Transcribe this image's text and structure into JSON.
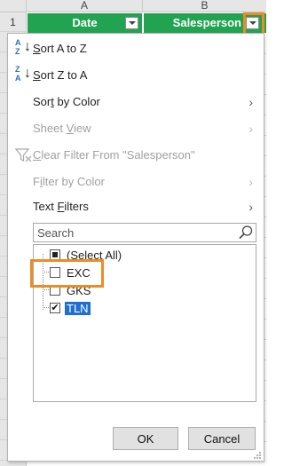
{
  "sheet": {
    "columns": [
      "A",
      "B"
    ],
    "first_row_number": "1",
    "header_cells": {
      "date": "Date",
      "salesperson": "Salesperson"
    }
  },
  "filter_menu": {
    "sort_a_to_z": {
      "prefix": "",
      "hot": "S",
      "rest": "ort A to Z",
      "icon": "sort-ascending-icon",
      "enabled": true
    },
    "sort_z_to_a": {
      "prefix": "",
      "hot": "S",
      "rest": "ort Z to A",
      "icon": "sort-descending-icon",
      "enabled": true
    },
    "sort_by_color": {
      "prefix": "Sor",
      "hot": "t",
      "rest": " by Color",
      "enabled": true,
      "has_submenu": true
    },
    "sheet_view": {
      "prefix": "Sheet ",
      "hot": "V",
      "rest": "iew",
      "enabled": false,
      "has_submenu": true
    },
    "clear_filter": {
      "prefix": "",
      "hot": "C",
      "rest": "lear Filter From \"Salesperson\"",
      "icon": "clear-filter-icon",
      "enabled": false
    },
    "filter_by_color": {
      "prefix": "F",
      "hot": "i",
      "rest": "lter by Color",
      "enabled": false,
      "has_submenu": true
    },
    "text_filters": {
      "prefix": "",
      "hot": "F",
      "rest": "",
      "pre": "Text ",
      "post": "ilters",
      "enabled": true,
      "has_submenu": true
    },
    "search": {
      "placeholder": "Search",
      "value": ""
    },
    "values": [
      {
        "label": "(Select All)",
        "state": "partial"
      },
      {
        "label": "EXC",
        "state": "unchecked"
      },
      {
        "label": "GKS",
        "state": "unchecked"
      },
      {
        "label": "TLN",
        "state": "checked",
        "selected": true
      }
    ],
    "ok_label": "OK",
    "cancel_label": "Cancel"
  },
  "colors": {
    "header_green": "#21a351",
    "highlight_orange": "#f08a24",
    "selection_blue": "#1e6fd0"
  }
}
